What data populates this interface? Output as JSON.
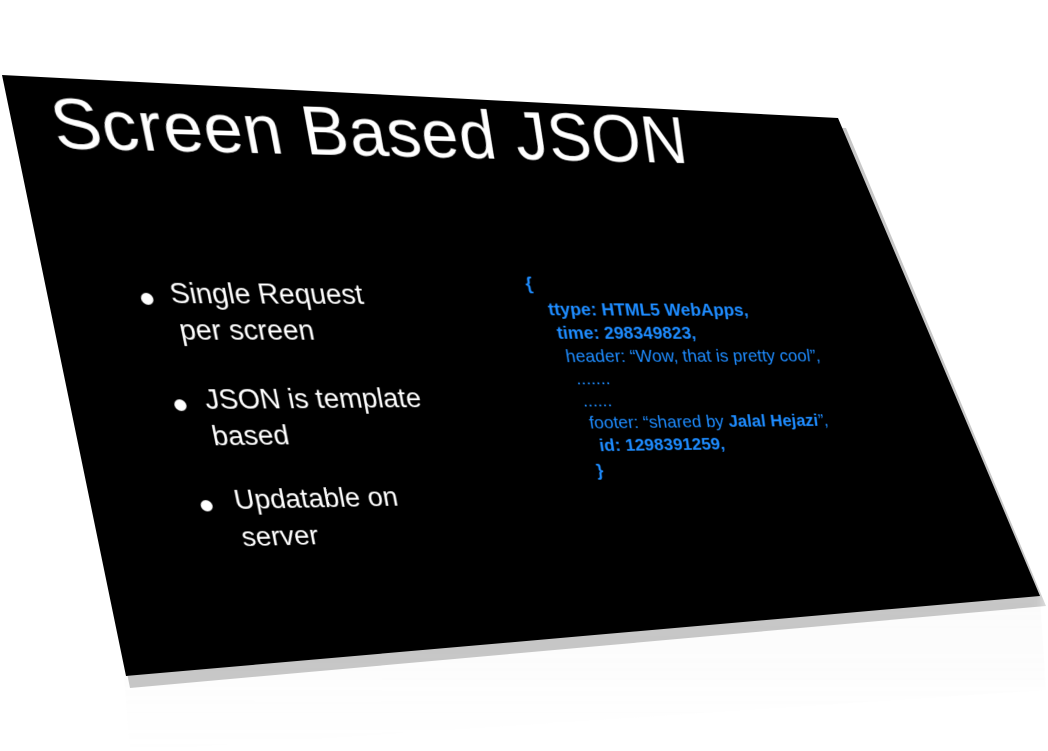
{
  "slide": {
    "title": "Screen Based JSON",
    "bullets": [
      {
        "line1": "Single Request",
        "line2": "per screen"
      },
      {
        "line1": "JSON is template",
        "line2": "based"
      },
      {
        "line1": "Updatable on",
        "line2": "server"
      }
    ],
    "code": {
      "open_brace": "{",
      "ttype": "ttype: HTML5 WebApps,",
      "time": "time: 298349823,",
      "header": "header:  “Wow, that is pretty cool”,",
      "ellipsis_1": ".......",
      "ellipsis_2": "......",
      "footer_prefix": "footer:  “shared by ",
      "footer_name": "Jalal Hejazi",
      "footer_suffix": "”,",
      "id": "id:  1298391259,",
      "close_brace": "}"
    }
  },
  "colors": {
    "slide_background": "#000000",
    "text": "#ffffff",
    "code": "#1e8cff"
  }
}
